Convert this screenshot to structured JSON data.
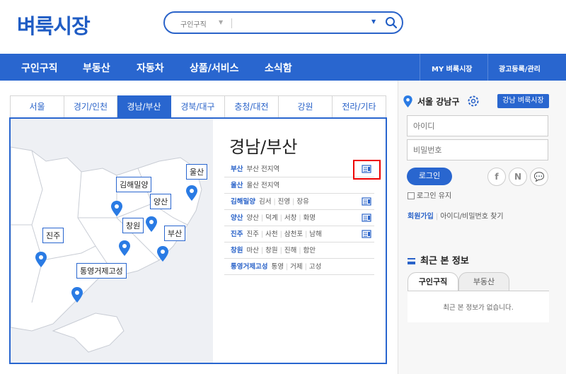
{
  "header": {
    "logo": "벼룩시장",
    "search": {
      "category": "구인구직",
      "value": "",
      "placeholder": ""
    }
  },
  "nav": {
    "items": [
      "구인구직",
      "부동산",
      "자동차",
      "상품/서비스",
      "소식함"
    ],
    "my": "MY 벼룩시장",
    "ads": "광고등록/관리"
  },
  "region_tabs": [
    "서울",
    "경기/인천",
    "경남/부산",
    "경북/대구",
    "충청/대전",
    "강원",
    "전라/기타"
  ],
  "region_active": "경남/부산",
  "region_panel": {
    "title": "경남/부산",
    "rows": [
      {
        "name": "부산",
        "subs": [
          "부산 전지역"
        ]
      },
      {
        "name": "울산",
        "subs": [
          "울산 전지역"
        ]
      },
      {
        "name": "김해밀양",
        "subs": [
          "김서",
          "진영",
          "장유"
        ]
      },
      {
        "name": "양산",
        "subs": [
          "양산",
          "덕계",
          "서창",
          "화명"
        ]
      },
      {
        "name": "진주",
        "subs": [
          "진주",
          "사천",
          "삼천포",
          "남해"
        ]
      },
      {
        "name": "창원",
        "subs": [
          "마산",
          "창원",
          "진해",
          "함안"
        ]
      },
      {
        "name": "통영거제고성",
        "subs": [
          "통영",
          "거제",
          "고성"
        ]
      }
    ],
    "map_labels": [
      "울산",
      "김해밀양",
      "양산",
      "창원",
      "부산",
      "진주",
      "통영거제고성"
    ]
  },
  "sidebar": {
    "location": "서울 강남구",
    "local_button": "강남 벼룩시장",
    "id_placeholder": "아이디",
    "pw_placeholder": "비밀번호",
    "login": "로그인",
    "sns": [
      "f",
      "N",
      "💬"
    ],
    "keep_login": "로그인 유지",
    "join": "회원가입",
    "find": "아이디/비밀번호 찾기",
    "recent_title": "최근 본 정보",
    "recent_tabs": [
      "구인구직",
      "부동산"
    ],
    "recent_empty": "최근 본 정보가 없습니다."
  },
  "colors": {
    "brand": "#2966cf",
    "highlight": "#e00000"
  }
}
